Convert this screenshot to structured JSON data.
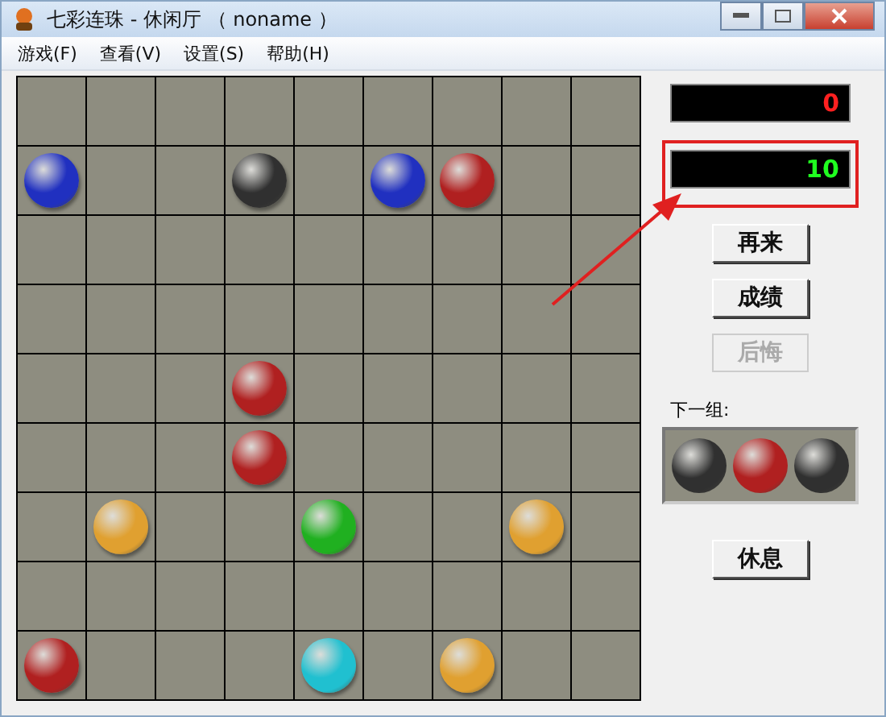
{
  "window": {
    "title": "七彩连珠 - 休闲厅 （ noname ）"
  },
  "menu": [
    {
      "label": "游戏(F)"
    },
    {
      "label": "查看(V)"
    },
    {
      "label": "设置(S)"
    },
    {
      "label": "帮助(H)"
    }
  ],
  "board": {
    "rows": [
      [
        {
          "kind": "empty"
        },
        {
          "kind": "empty"
        },
        {
          "kind": "empty"
        },
        {
          "kind": "empty"
        },
        {
          "kind": "empty"
        },
        {
          "kind": "empty"
        },
        {
          "kind": "empty"
        },
        {
          "kind": "empty"
        },
        {
          "kind": "empty"
        }
      ],
      [
        {
          "kind": "ball",
          "color": "#2030c0"
        },
        {
          "kind": "empty"
        },
        {
          "kind": "empty"
        },
        {
          "kind": "ball",
          "color": "#303030"
        },
        {
          "kind": "empty"
        },
        {
          "kind": "ball",
          "color": "#2030c0"
        },
        {
          "kind": "ball",
          "color": "#b02020"
        },
        {
          "kind": "empty"
        },
        {
          "kind": "empty"
        }
      ],
      [
        {
          "kind": "empty"
        },
        {
          "kind": "empty"
        },
        {
          "kind": "empty"
        },
        {
          "kind": "empty"
        },
        {
          "kind": "empty"
        },
        {
          "kind": "empty"
        },
        {
          "kind": "empty"
        },
        {
          "kind": "empty"
        },
        {
          "kind": "empty"
        }
      ],
      [
        {
          "kind": "empty"
        },
        {
          "kind": "empty"
        },
        {
          "kind": "empty"
        },
        {
          "kind": "empty"
        },
        {
          "kind": "empty"
        },
        {
          "kind": "empty"
        },
        {
          "kind": "empty"
        },
        {
          "kind": "empty"
        },
        {
          "kind": "empty"
        }
      ],
      [
        {
          "kind": "empty"
        },
        {
          "kind": "empty"
        },
        {
          "kind": "empty"
        },
        {
          "kind": "ball",
          "color": "#b02020"
        },
        {
          "kind": "empty"
        },
        {
          "kind": "empty"
        },
        {
          "kind": "empty"
        },
        {
          "kind": "empty"
        },
        {
          "kind": "empty"
        }
      ],
      [
        {
          "kind": "empty"
        },
        {
          "kind": "empty"
        },
        {
          "kind": "empty"
        },
        {
          "kind": "ball",
          "color": "#b02020"
        },
        {
          "kind": "empty"
        },
        {
          "kind": "empty"
        },
        {
          "kind": "empty"
        },
        {
          "kind": "empty"
        },
        {
          "kind": "empty"
        }
      ],
      [
        {
          "kind": "empty"
        },
        {
          "kind": "ball",
          "color": "#e0a030"
        },
        {
          "kind": "empty"
        },
        {
          "kind": "empty"
        },
        {
          "kind": "ball",
          "color": "#20b020"
        },
        {
          "kind": "empty"
        },
        {
          "kind": "empty"
        },
        {
          "kind": "ball",
          "color": "#e0a030"
        },
        {
          "kind": "empty"
        }
      ],
      [
        {
          "kind": "empty"
        },
        {
          "kind": "empty"
        },
        {
          "kind": "empty"
        },
        {
          "kind": "empty"
        },
        {
          "kind": "empty"
        },
        {
          "kind": "empty"
        },
        {
          "kind": "empty"
        },
        {
          "kind": "empty"
        },
        {
          "kind": "empty"
        }
      ],
      [
        {
          "kind": "ball",
          "color": "#b02020"
        },
        {
          "kind": "empty"
        },
        {
          "kind": "empty"
        },
        {
          "kind": "empty"
        },
        {
          "kind": "ball",
          "color": "#20c0d0"
        },
        {
          "kind": "empty"
        },
        {
          "kind": "ball",
          "color": "#e0a030"
        },
        {
          "kind": "empty"
        },
        {
          "kind": "empty"
        }
      ]
    ]
  },
  "scores": [
    {
      "value": "0",
      "color": "#ff2020",
      "highlighted": false
    },
    {
      "value": "10",
      "color": "#20ff20",
      "highlighted": true
    }
  ],
  "buttons": [
    {
      "label": "再来",
      "disabled": false
    },
    {
      "label": "成绩",
      "disabled": false
    },
    {
      "label": "后悔",
      "disabled": true
    }
  ],
  "next": {
    "label": "下一组:",
    "balls": [
      {
        "color": "#303030"
      },
      {
        "color": "#b02020"
      },
      {
        "color": "#303030"
      }
    ]
  },
  "rest_button": {
    "label": "休息"
  }
}
